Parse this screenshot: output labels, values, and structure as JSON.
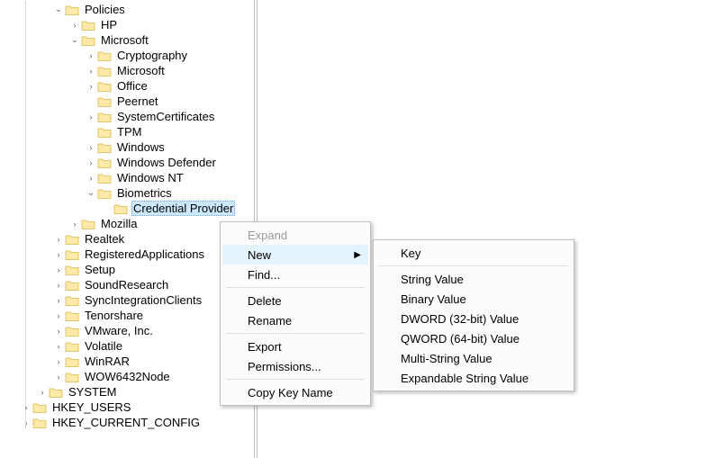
{
  "tree": {
    "policies": "Policies",
    "hp": "HP",
    "microsoft": "Microsoft",
    "cryptography": "Cryptography",
    "microsoft2": "Microsoft",
    "office": "Office",
    "peernet": "Peernet",
    "systemcertificates": "SystemCertificates",
    "tpm": "TPM",
    "windows": "Windows",
    "windows_defender": "Windows Defender",
    "windows_nt": "Windows NT",
    "biometrics": "Biometrics",
    "credential_provider": "Credential Provider",
    "mozilla": "Mozilla",
    "realtek": "Realtek",
    "registeredapplications": "RegisteredApplications",
    "setup": "Setup",
    "soundresearch": "SoundResearch",
    "syncintegrationclients": "SyncIntegrationClients",
    "tenorshare": "Tenorshare",
    "vmware": "VMware, Inc.",
    "volatile": "Volatile",
    "winrar": "WinRAR",
    "wow6432node": "WOW6432Node",
    "system": "SYSTEM",
    "hkey_users": "HKEY_USERS",
    "hkey_current_config": "HKEY_CURRENT_CONFIG"
  },
  "menu": {
    "expand": "Expand",
    "new": "New",
    "find": "Find...",
    "delete": "Delete",
    "rename": "Rename",
    "export": "Export",
    "permissions": "Permissions...",
    "copy_key_name": "Copy Key Name"
  },
  "submenu": {
    "key": "Key",
    "string_value": "String Value",
    "binary_value": "Binary Value",
    "dword_value": "DWORD (32-bit) Value",
    "qword_value": "QWORD (64-bit) Value",
    "multi_string_value": "Multi-String Value",
    "expandable_string_value": "Expandable String Value"
  },
  "glyphs": {
    "expanded": "⌄",
    "collapsed": "›",
    "submenu_arrow": "▶"
  }
}
